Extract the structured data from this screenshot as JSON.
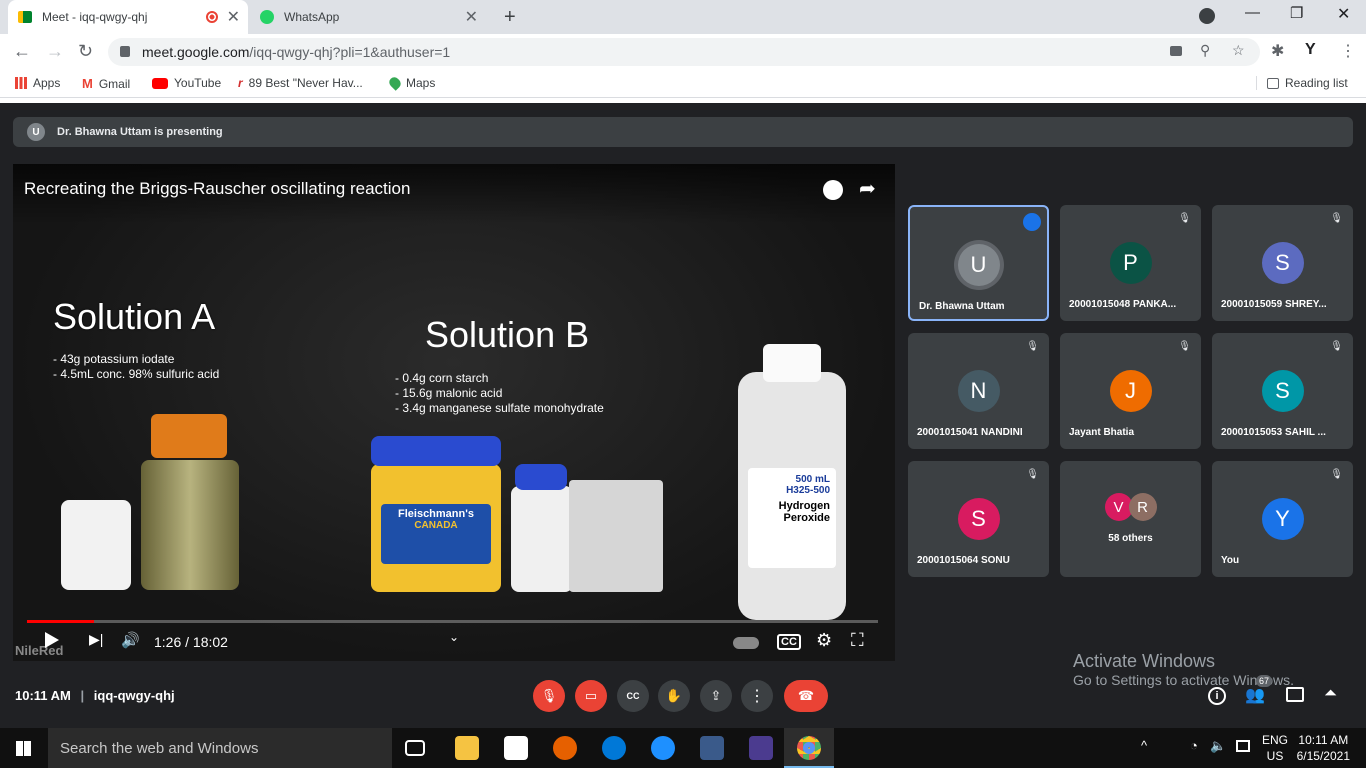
{
  "browser": {
    "tabs": [
      {
        "title": "Meet - iqq-qwgy-qhj"
      },
      {
        "title": "WhatsApp"
      }
    ],
    "new_tab": "+",
    "url_host": "meet.google.com",
    "url_path": "/iqq-qwgy-qhj?pli=1&authuser=1",
    "bookmarks": [
      "Apps",
      "Gmail",
      "YouTube",
      "89 Best \"Never Hav...",
      "Maps"
    ],
    "reading_list": "Reading list"
  },
  "meet": {
    "presenting_badge": "U",
    "presenting_text": "Dr. Bhawna Uttam is presenting",
    "video": {
      "title": "Recreating the Briggs-Rauscher oscillating reaction",
      "solution_a": "Solution A",
      "solution_a_items": [
        "- 43g potassium iodate",
        "- 4.5mL conc. 98% sulfuric acid"
      ],
      "solution_b": "Solution B",
      "solution_b_items": [
        "- 0.4g corn starch",
        "- 15.6g malonic acid",
        "- 3.4g manganese sulfate monohydrate"
      ],
      "jar_brand": "Fleischmann's",
      "jar_sub": "CANADA",
      "peroxide_label": "Hydrogen Peroxide",
      "peroxide_volume": "500 mL",
      "peroxide_code": "H325-500",
      "time": "1:26 / 18:02",
      "progress": 0.079,
      "watermark": "NileRed"
    },
    "participants": [
      {
        "initial": "U",
        "name": "Dr. Bhawna Uttam",
        "color": "#80868b",
        "speaking": true
      },
      {
        "initial": "P",
        "name": "20001015048 PANKA...",
        "color": "#0b5345"
      },
      {
        "initial": "S",
        "name": "20001015059 SHREY...",
        "color": "#5c6bc0"
      },
      {
        "initial": "N",
        "name": "20001015041 NANDINI",
        "color": "#455a64"
      },
      {
        "initial": "J",
        "name": "Jayant Bhatia",
        "color": "#ef6c00"
      },
      {
        "initial": "S",
        "name": "20001015053 SAHIL ...",
        "color": "#0097a7"
      },
      {
        "initial": "S",
        "name": "20001015064 SONU",
        "color": "#d81b60"
      },
      {
        "initial": "V",
        "initial2": "R",
        "name": "58 others",
        "color": "#d81b60",
        "color2": "#8d6e63"
      },
      {
        "initial": "Y",
        "name": "You",
        "color": "#1a73e8"
      }
    ],
    "bottom_time": "10:11 AM",
    "meeting_code": "iqq-qwgy-qhj",
    "people_count": "67",
    "activate_title": "Activate Windows",
    "activate_sub": "Go to Settings to activate Windows."
  },
  "taskbar": {
    "search_placeholder": "Search the web and Windows",
    "lang1": "ENG",
    "lang2": "US",
    "time": "10:11 AM",
    "date": "6/15/2021"
  }
}
